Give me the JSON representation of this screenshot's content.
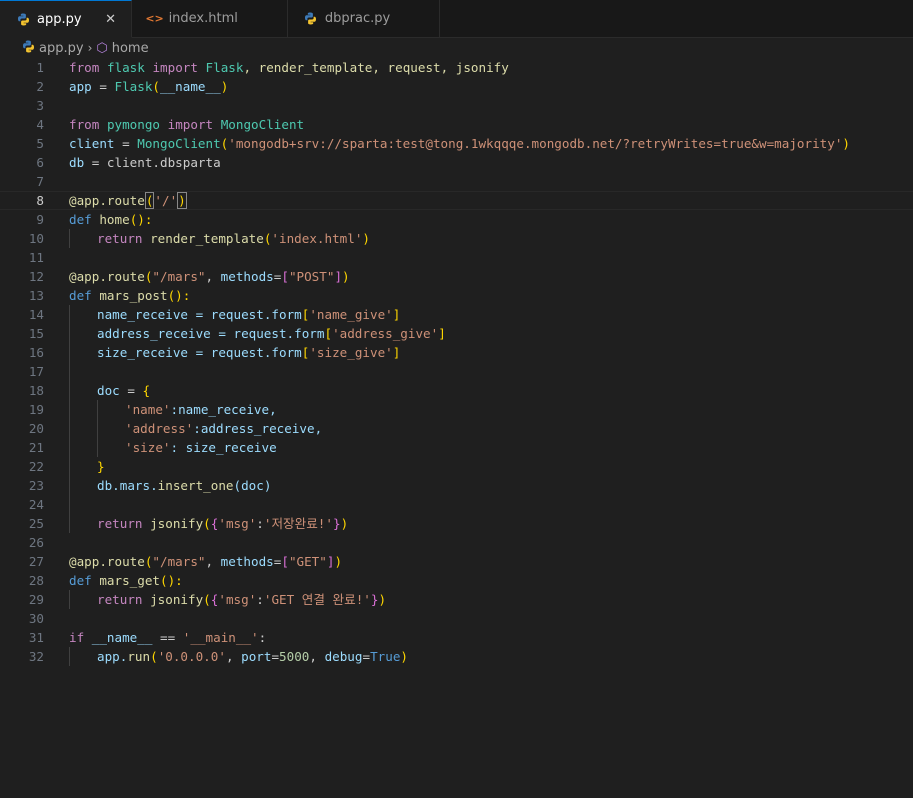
{
  "tabs": [
    {
      "label": "app.py",
      "icon": "python-icon",
      "active": true
    },
    {
      "label": "index.html",
      "icon": "html-icon",
      "active": false
    },
    {
      "label": "dbprac.py",
      "icon": "python-icon",
      "active": false
    }
  ],
  "breadcrumb": {
    "file": "app.py",
    "symbol": "home"
  },
  "current_line": 8,
  "lines": [
    {
      "n": "1"
    },
    {
      "n": "2"
    },
    {
      "n": "3"
    },
    {
      "n": "4"
    },
    {
      "n": "5"
    },
    {
      "n": "6"
    },
    {
      "n": "7"
    },
    {
      "n": "8"
    },
    {
      "n": "9"
    },
    {
      "n": "10"
    },
    {
      "n": "11"
    },
    {
      "n": "12"
    },
    {
      "n": "13"
    },
    {
      "n": "14"
    },
    {
      "n": "15"
    },
    {
      "n": "16"
    },
    {
      "n": "17"
    },
    {
      "n": "18"
    },
    {
      "n": "19"
    },
    {
      "n": "20"
    },
    {
      "n": "21"
    },
    {
      "n": "22"
    },
    {
      "n": "23"
    },
    {
      "n": "24"
    },
    {
      "n": "25"
    },
    {
      "n": "26"
    },
    {
      "n": "27"
    },
    {
      "n": "28"
    },
    {
      "n": "29"
    },
    {
      "n": "30"
    },
    {
      "n": "31"
    },
    {
      "n": "32"
    }
  ],
  "code": {
    "l1": {
      "a": "from",
      "b": "flask",
      "c": "import",
      "d": "Flask",
      "e": ", render_template, request, jsonify"
    },
    "l2": {
      "a": "app",
      "b": " = ",
      "c": "Flask",
      "d": "(",
      "e": "__name__",
      "f": ")"
    },
    "l4": {
      "a": "from",
      "b": "pymongo",
      "c": "import",
      "d": "MongoClient"
    },
    "l5": {
      "a": "client",
      "b": " = ",
      "c": "MongoClient",
      "d": "(",
      "e": "'mongodb+srv://sparta:test@tong.1wkqqqe.mongodb.net/?retryWrites=true&w=majority'",
      "f": ")"
    },
    "l6": {
      "a": "db",
      "b": " = client.dbsparta"
    },
    "l8": {
      "a": "@app.route",
      "b": "(",
      "c": "'/'",
      "d": ")"
    },
    "l9": {
      "a": "def",
      "b": "home",
      "c": "():"
    },
    "l10": {
      "a": "return",
      "b": "render_template",
      "c": "(",
      "d": "'index.html'",
      "e": ")"
    },
    "l12": {
      "a": "@app.route",
      "b": "(",
      "c": "\"/mars\"",
      "d": ", ",
      "e": "methods",
      "f": "=",
      "g": "[",
      "h": "\"POST\"",
      "i": "]",
      "j": ")"
    },
    "l13": {
      "a": "def",
      "b": "mars_post",
      "c": "():"
    },
    "l14": {
      "a": "name_receive",
      "b": " = request.form",
      "c": "[",
      "d": "'name_give'",
      "e": "]"
    },
    "l15": {
      "a": "address_receive",
      "b": " = request.form",
      "c": "[",
      "d": "'address_give'",
      "e": "]"
    },
    "l16": {
      "a": "size_receive",
      "b": " = request.form",
      "c": "[",
      "d": "'size_give'",
      "e": "]"
    },
    "l18": {
      "a": "doc",
      "b": " = ",
      "c": "{"
    },
    "l19": {
      "a": "'name'",
      "b": ":name_receive,"
    },
    "l20": {
      "a": "'address'",
      "b": ":address_receive,"
    },
    "l21": {
      "a": "'size'",
      "b": ": size_receive"
    },
    "l22": {
      "a": "}"
    },
    "l23": {
      "a": "db.mars.",
      "b": "insert_one",
      "c": "(doc)"
    },
    "l25": {
      "a": "return",
      "b": "jsonify",
      "c": "(",
      "d": "{",
      "e": "'msg'",
      "f": ":",
      "g": "'저장완료!'",
      "h": "}",
      "i": ")"
    },
    "l27": {
      "a": "@app.route",
      "b": "(",
      "c": "\"/mars\"",
      "d": ", ",
      "e": "methods",
      "f": "=",
      "g": "[",
      "h": "\"GET\"",
      "i": "]",
      "j": ")"
    },
    "l28": {
      "a": "def",
      "b": "mars_get",
      "c": "():"
    },
    "l29": {
      "a": "return",
      "b": "jsonify",
      "c": "(",
      "d": "{",
      "e": "'msg'",
      "f": ":",
      "g": "'GET 연결 완료!'",
      "h": "}",
      "i": ")"
    },
    "l31": {
      "a": "if",
      "b": "__name__",
      "c": " == ",
      "d": "'__main__'",
      "e": ":"
    },
    "l32": {
      "a": "app.",
      "b": "run",
      "c": "(",
      "d": "'0.0.0.0'",
      "e": ", ",
      "f": "port",
      "g": "=",
      "h": "5000",
      "i": ", ",
      "j": "debug",
      "k": "=",
      "l": "True",
      "m": ")"
    }
  }
}
